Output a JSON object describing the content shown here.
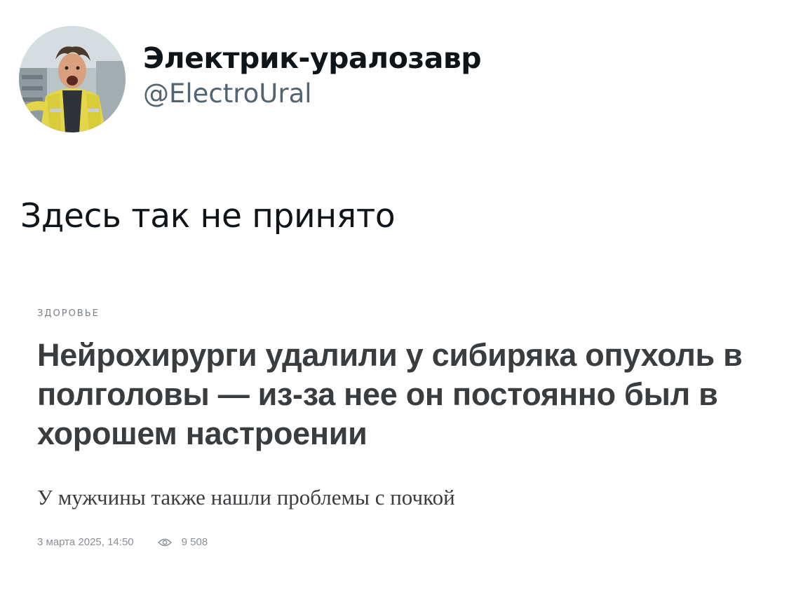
{
  "author": {
    "name": "Электрик-уралозавр",
    "handle": "@ElectroUral"
  },
  "tweet": {
    "text": "Здесь так не принято"
  },
  "article": {
    "category": "ЗДОРОВЬЕ",
    "headline": "Нейрохирурги удалили у сибиряка опухоль в полголовы — из-за нее он постоянно был в хорошем настроении",
    "subtitle": "У мужчины также нашли проблемы с почкой",
    "date": "3 марта 2025, 14:50",
    "views": "9 508",
    "views_icon": "eye-icon"
  }
}
